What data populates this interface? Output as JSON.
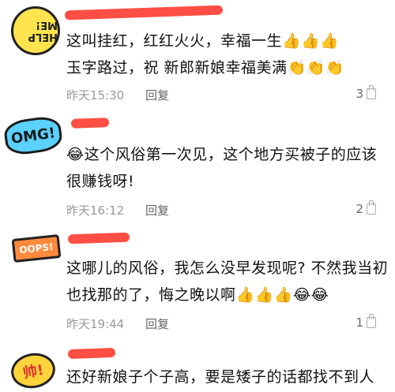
{
  "comments": [
    {
      "avatar_text": "HELP ME!",
      "lines": [
        "这叫挂红，红红火火，幸福一生👍👍👍",
        "玉字路过，祝 新郎新娘幸福美满👏👏👏"
      ],
      "time": "昨天15:30",
      "reply_label": "回复",
      "likes": "3"
    },
    {
      "avatar_text": "OMG!",
      "lines": [
        "😂这个风俗第一次见，这个地方买被子的应该",
        "很赚钱呀!"
      ],
      "time": "昨天16:12",
      "reply_label": "回复",
      "likes": "2"
    },
    {
      "avatar_text": "OOPS!",
      "lines": [
        "这哪儿的风俗，我怎么没早发现呢? 不然我当初",
        "也找那的了，悔之晚以啊👍👍👍😂😂"
      ],
      "time": "昨天19:44",
      "reply_label": "回复",
      "likes": "1"
    },
    {
      "avatar_text": "帅!",
      "lines": [
        "还好新娘子个子高，要是矮子的话都找不到人"
      ],
      "time": "",
      "reply_label": "",
      "likes": ""
    }
  ]
}
